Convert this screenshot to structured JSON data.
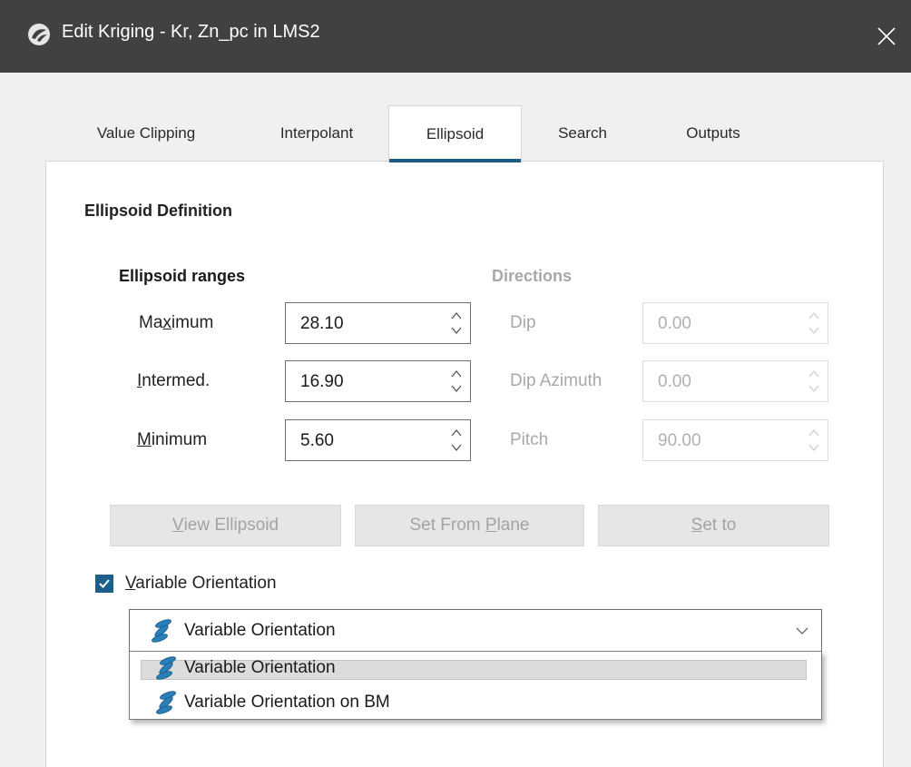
{
  "window": {
    "title": "Edit Kriging - Kr, Zn_pc in LMS2",
    "icon": "leapfrog-app-icon",
    "close_icon": "close-icon"
  },
  "tabs": [
    {
      "label": "Value Clipping",
      "active": false
    },
    {
      "label": "Interpolant",
      "active": false
    },
    {
      "label": "Ellipsoid",
      "active": true
    },
    {
      "label": "Search",
      "active": false
    },
    {
      "label": "Outputs",
      "active": false
    }
  ],
  "ellipsoid": {
    "section_title": "Ellipsoid Definition",
    "ranges_title": "Ellipsoid ranges",
    "directions_title": "Directions",
    "ranges": {
      "maximum": {
        "label_pre": "Ma",
        "label_ul": "x",
        "label_post": "imum",
        "value": "28.10"
      },
      "intermed": {
        "label_pre": "",
        "label_ul": "I",
        "label_post": "ntermed.",
        "value": "16.90"
      },
      "minimum": {
        "label_pre": "",
        "label_ul": "M",
        "label_post": "inimum",
        "value": "5.60"
      }
    },
    "directions": {
      "dip": {
        "label": "Dip",
        "value": "0.00"
      },
      "dip_azimuth": {
        "label": "Dip Azimuth",
        "value": "0.00"
      },
      "pitch": {
        "label": "Pitch",
        "value": "90.00"
      }
    },
    "buttons": {
      "view_pre": "",
      "view_ul": "V",
      "view_post": "iew Ellipsoid",
      "plane_pre": "Set From ",
      "plane_ul": "P",
      "plane_post": "lane",
      "set_pre": "",
      "set_ul": "S",
      "set_post": "et to"
    }
  },
  "variable_orientation": {
    "checked": true,
    "label_ul": "V",
    "label_post": "ariable Orientation",
    "selected": "Variable Orientation",
    "options": [
      "Variable Orientation",
      "Variable Orientation on BM"
    ]
  },
  "colors": {
    "titlebar": "#414141",
    "accent": "#1c5d86",
    "icon_blue": "#2a7fb8"
  }
}
